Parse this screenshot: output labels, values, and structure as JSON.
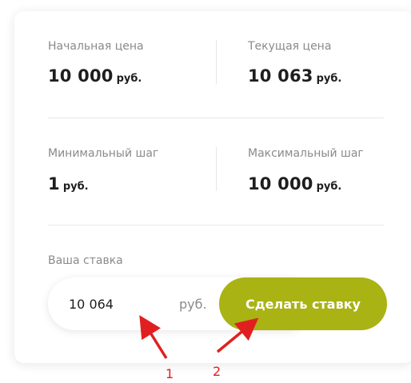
{
  "auction": {
    "start_price": {
      "label": "Начальная цена",
      "amount": "10 000",
      "currency": "руб."
    },
    "current_price": {
      "label": "Текущая цена",
      "amount": "10 063",
      "currency": "руб."
    },
    "min_step": {
      "label": "Минимальный шаг",
      "amount": "1",
      "currency": "руб."
    },
    "max_step": {
      "label": "Максимальный шаг",
      "amount": "10 000",
      "currency": "руб."
    }
  },
  "bid": {
    "label": "Ваша ставка",
    "value": "10 064",
    "currency": "руб.",
    "button_label": "Сделать ставку"
  },
  "annotations": {
    "arrow1_label": "1",
    "arrow2_label": "2"
  },
  "colors": {
    "accent": "#a9b314",
    "annotation": "#e02020"
  }
}
